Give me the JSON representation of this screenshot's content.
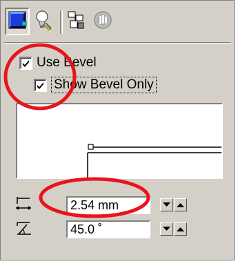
{
  "toolbar": {
    "icons": [
      "bevel-icon",
      "lighting-icon",
      "copy-properties-icon",
      "clear-icon"
    ]
  },
  "bevel": {
    "use_bevel_label": "Use Bevel",
    "use_bevel_checked": true,
    "show_only_label": "Show Bevel Only",
    "show_only_checked": true
  },
  "width_field": {
    "value": "2.54 mm"
  },
  "angle_field": {
    "value": "45.0 ˚"
  },
  "colors": {
    "panel": "#d4d0c8",
    "highlight_ellipse": "#e8141c",
    "bevel_icon_blue": "#1f3bd6"
  }
}
